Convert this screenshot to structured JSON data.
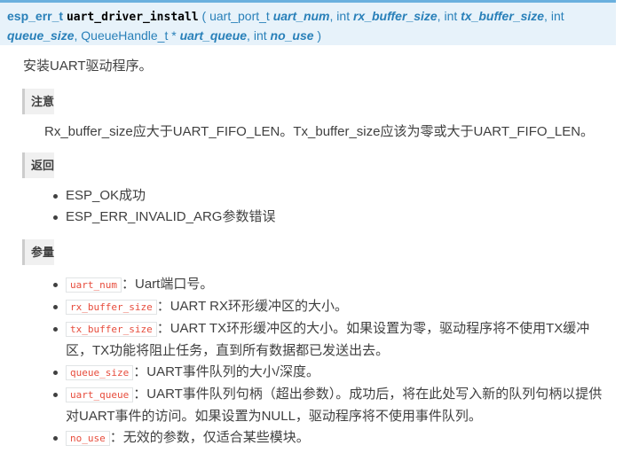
{
  "signature": {
    "return_type": "esp_err_t",
    "func_name": "uart_driver_install",
    "open_paren": "(",
    "close_paren": ")",
    "params": [
      {
        "type": "uart_port_t",
        "name": "uart_num"
      },
      {
        "type": "int",
        "name": "rx_buffer_size"
      },
      {
        "type": "int",
        "name": "tx_buffer_size"
      },
      {
        "type": "int",
        "name": "queue_size"
      },
      {
        "type": "QueueHandle_t *",
        "name": "uart_queue"
      },
      {
        "type": "int",
        "name": "no_use"
      }
    ],
    "separator": ","
  },
  "description": "安装UART驱动程序。",
  "note": {
    "label": "注意",
    "text": "Rx_buffer_size应大于UART_FIFO_LEN。Tx_buffer_size应该为零或大于UART_FIFO_LEN。"
  },
  "returns": {
    "label": "返回",
    "items": [
      "ESP_OK成功",
      "ESP_ERR_INVALID_ARG参数错误"
    ]
  },
  "parameters": {
    "label": "参量",
    "items": [
      {
        "code": "uart_num",
        "text": "：Uart端口号。"
      },
      {
        "code": "rx_buffer_size",
        "text": "：UART RX环形缓冲区的大小。"
      },
      {
        "code": "tx_buffer_size",
        "text": "：UART TX环形缓冲区的大小。如果设置为零，驱动程序将不使用TX缓冲区，TX功能将阻止任务，直到所有数据都已发送出去。"
      },
      {
        "code": "queue_size",
        "text": "：UART事件队列的大小/深度。"
      },
      {
        "code": "uart_queue",
        "text": "：UART事件队列句柄（超出参数）。成功后，将在此处写入新的队列句柄以提供对UART事件的访问。如果设置为NULL，驱动程序将不使用事件队列。"
      },
      {
        "code": "no_use",
        "text": "：无效的参数，仅适合某些模块。"
      }
    ]
  }
}
